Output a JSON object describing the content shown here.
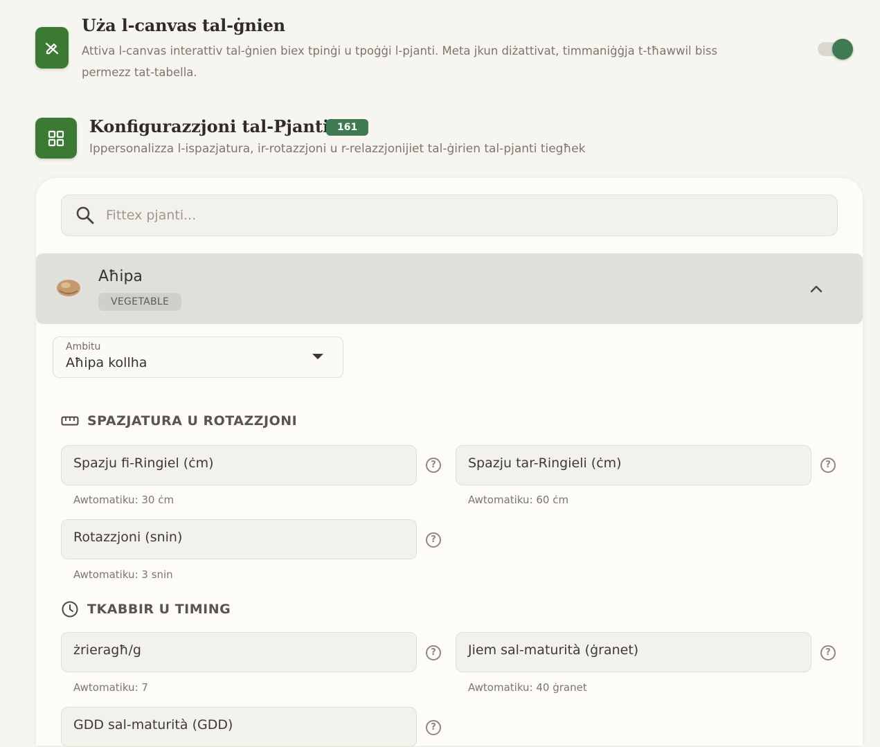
{
  "canvas_setting": {
    "title": "Uża l-canvas tal-ġnien",
    "description": "Attiva l-canvas interattiv tal-ġnien biex tpinġi u tpoġġi l-pjanti. Meta jkun diżattivat, timmaniġġja t-tħawwil biss permezz tat-tabella.",
    "enabled": true,
    "icon": "pencil-off-icon"
  },
  "plant_config": {
    "title": "Konfigurazzjoni tal-Pjanti",
    "count": "161",
    "description": "Ippersonalizza l-ispazjatura, ir-rotazzjoni u r-relazzjonijiet tal-ġirien tal-pjanti tiegħek",
    "icon": "grid-icon"
  },
  "search": {
    "placeholder": "Fittex pjanti...",
    "value": ""
  },
  "plant": {
    "name": "Aħipa",
    "category": "VEGETABLE",
    "expanded": true
  },
  "scope": {
    "label": "Ambitu",
    "value": "Aħipa kollha"
  },
  "spacing_group": {
    "heading": "SPAZJATURA U ROTAZZJONI",
    "fields": [
      {
        "label": "Spazju fi-Ringiel (ċm)",
        "hint": "Awtomatiku: 30 ċm"
      },
      {
        "label": "Spazju tar-Ringieli (ċm)",
        "hint": "Awtomatiku: 60 ċm"
      },
      {
        "label": "Rotazzjoni (snin)",
        "hint": "Awtomatiku: 3 snin"
      }
    ]
  },
  "timing_group": {
    "heading": "TKABBIR U TIMING",
    "fields": [
      {
        "label": "żrieragħ/g",
        "hint": "Awtomatiku: 7"
      },
      {
        "label": "Jiem sal-maturità (ġranet)",
        "hint": "Awtomatiku: 40 ġranet"
      },
      {
        "label": "GDD sal-maturità (GDD)",
        "hint": ""
      }
    ]
  },
  "colors": {
    "accent": "#3f7a52",
    "icon_bg": "#3b7a33",
    "page_bg": "#f6f5f0"
  }
}
